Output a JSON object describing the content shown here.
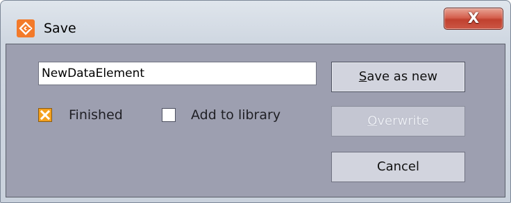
{
  "window": {
    "title": "Save",
    "close_label": "X",
    "accent_color": "#f37a2a"
  },
  "form": {
    "name_value": "NewDataElement"
  },
  "options": {
    "finished": {
      "label": "Finished",
      "checked": true
    },
    "add_to_library": {
      "label": "Add to library",
      "checked": false
    }
  },
  "buttons": {
    "save_as_new": {
      "mnemonic": "S",
      "rest": "ave as new",
      "enabled": true
    },
    "overwrite": {
      "mnemonic": "O",
      "rest": "verwrite",
      "enabled": false
    },
    "cancel": {
      "label": "Cancel",
      "enabled": true
    }
  },
  "icons": {
    "app": "app-logo-icon",
    "close": "close-icon",
    "check": "check-mark-icon"
  }
}
